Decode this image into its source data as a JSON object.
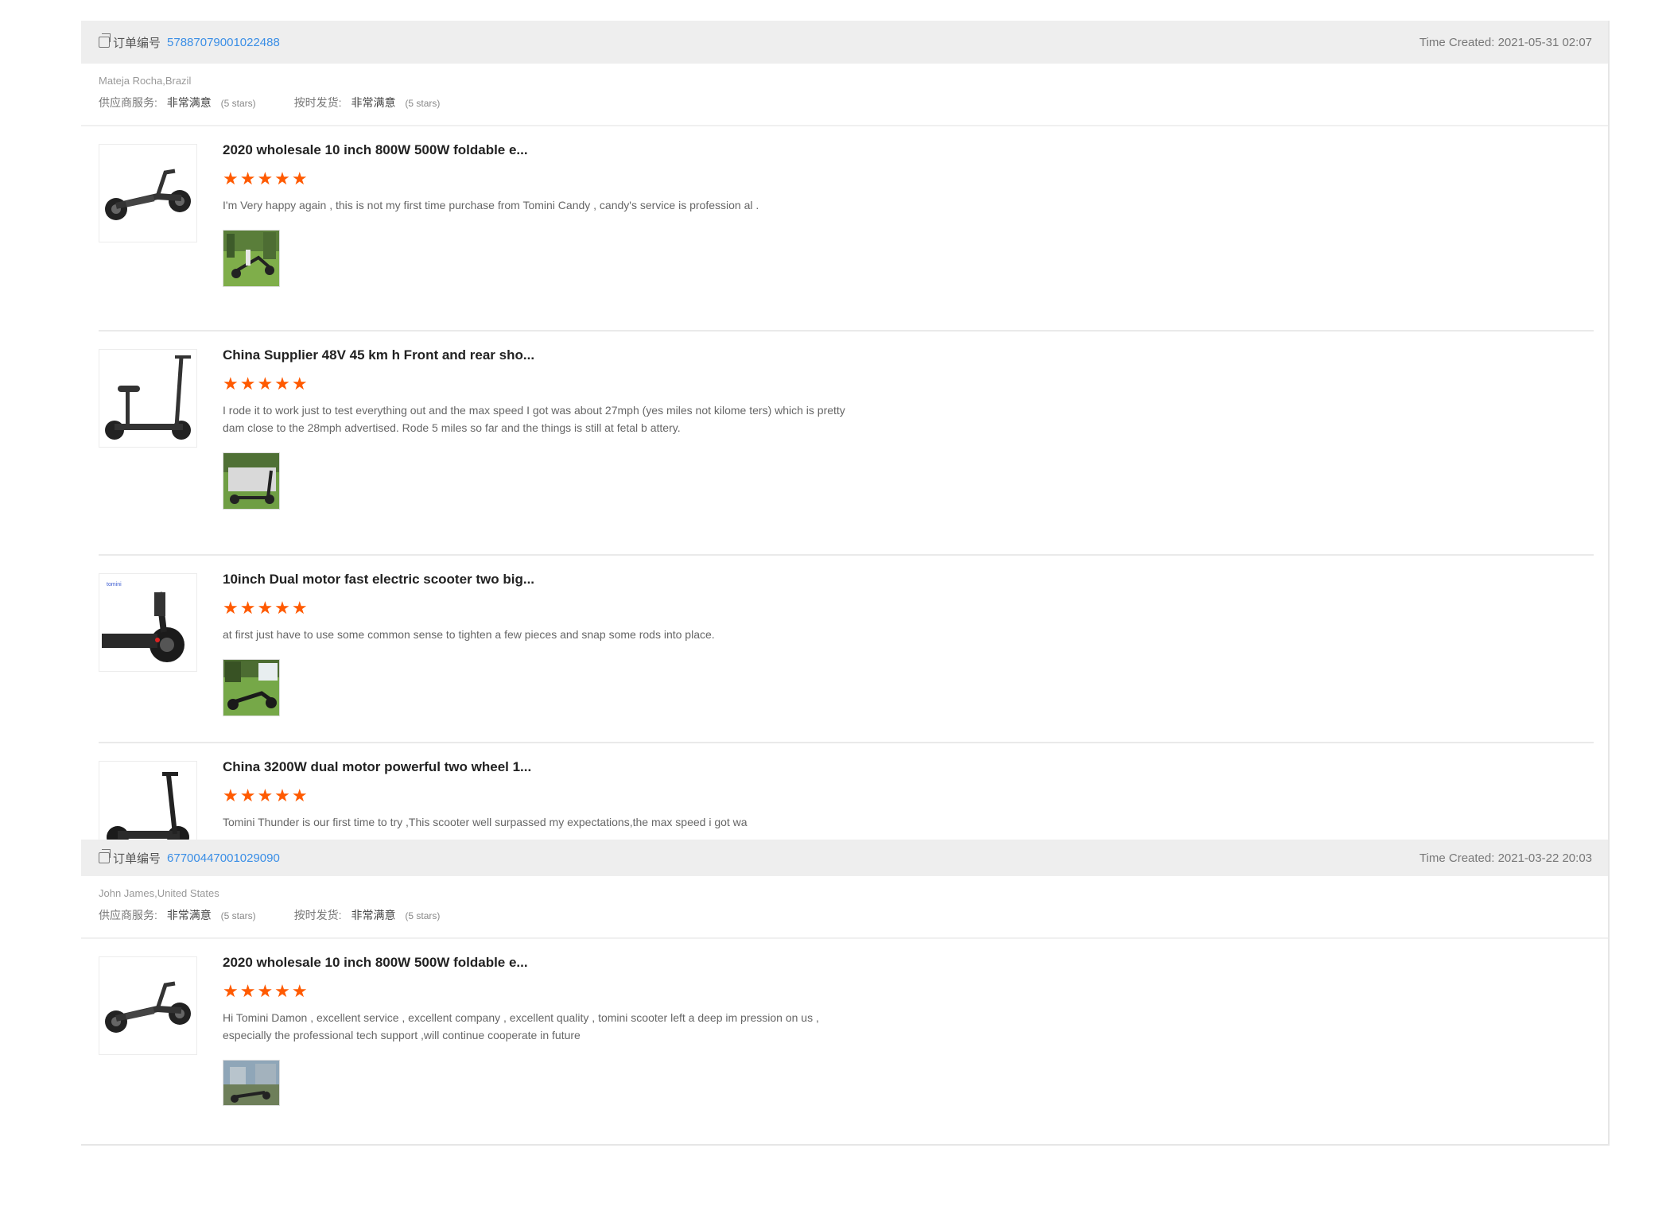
{
  "orders": [
    {
      "order_label": "订单编号",
      "order_number": "5788707900102248​8",
      "time_created": "Time Created: 2021-05-31 02:07",
      "buyer": "Mateja Rocha,Brazil",
      "supplier_service_label": "供应商服务:",
      "supplier_service_value": "非常满意",
      "supplier_service_stars": "(5 stars)",
      "ontime_label": "按时发货:",
      "ontime_value": "非常满意",
      "ontime_stars": "(5 stars)",
      "reviews": [
        {
          "title": "2020 wholesale 10 inch 800W 500W foldable e...",
          "stars": "★★★★★",
          "text": "I'm Very happy again , this is not my first time purchase from Tomini Candy ,  candy's service is profession al ."
        },
        {
          "title": "China Supplier 48V 45 km h Front and rear sho...",
          "stars": "★★★★★",
          "text": "I rode it to work just to test everything out and the max speed I got was about 27mph (yes miles not kilome ters) which is pretty dam close to the 28mph advertised. Rode 5 miles so far and the things is still at fetal b attery."
        },
        {
          "title": "10inch Dual motor fast electric scooter two big...",
          "stars": "★★★★★",
          "text": " at first just have to use some common sense to tighten a few pieces and snap some rods into place."
        },
        {
          "title": "China 3200W dual motor powerful two wheel 1...",
          "stars": "★★★★★",
          "text": "Tomini Thunder is our first time to try ,This scooter well surpassed my expectations,the max speed i got wa"
        }
      ]
    },
    {
      "order_label": "订单编号",
      "order_number": "67700447001029090",
      "time_created": "Time Created: 2021-03-22 20:03",
      "buyer": "John James,United States",
      "supplier_service_label": "供应商服务:",
      "supplier_service_value": "非常满意",
      "supplier_service_stars": "(5 stars)",
      "ontime_label": "按时发货:",
      "ontime_value": "非常满意",
      "ontime_stars": "(5 stars)",
      "reviews": [
        {
          "title": "2020 wholesale 10 inch 800W 500W foldable e...",
          "stars": "★★★★★",
          "text": "Hi Tomini Damon ,  excellent service , excellent company , excellent quality ,  tomini scooter left a deep im pression on us ,  especially the professional tech support ,will continue cooperate in future"
        }
      ]
    }
  ],
  "colors": {
    "star": "#ff5a00",
    "link": "#3a8ee6",
    "header_bg": "#eeeeee"
  }
}
